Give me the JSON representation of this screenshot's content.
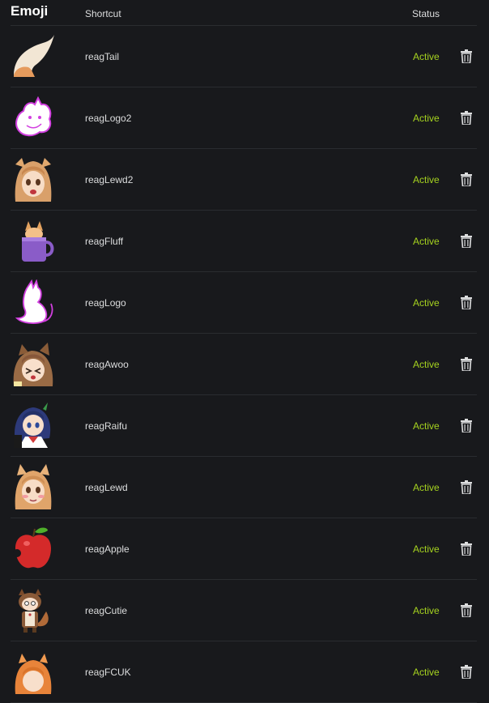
{
  "header": {
    "emoji_label": "Emoji",
    "shortcut_label": "Shortcut",
    "status_label": "Status"
  },
  "colors": {
    "background": "#18191c",
    "status_active": "#a5d21f",
    "divider": "#2a2c30"
  },
  "rows": [
    {
      "shortcut": "reagTail",
      "status": "Active",
      "icon": "fox-tail-icon"
    },
    {
      "shortcut": "reagLogo2",
      "status": "Active",
      "icon": "white-creature-logo-icon"
    },
    {
      "shortcut": "reagLewd2",
      "status": "Active",
      "icon": "anime-fox-girl-icon"
    },
    {
      "shortcut": "reagFluff",
      "status": "Active",
      "icon": "fox-in-mug-icon"
    },
    {
      "shortcut": "reagLogo",
      "status": "Active",
      "icon": "sitting-fox-logo-icon"
    },
    {
      "shortcut": "reagAwoo",
      "status": "Active",
      "icon": "anime-wolf-girl-icon"
    },
    {
      "shortcut": "reagRaifu",
      "status": "Active",
      "icon": "anime-schoolgirl-icon"
    },
    {
      "shortcut": "reagLewd",
      "status": "Active",
      "icon": "blushing-fox-girl-icon"
    },
    {
      "shortcut": "reagApple",
      "status": "Active",
      "icon": "red-apple-icon"
    },
    {
      "shortcut": "reagCutie",
      "status": "Active",
      "icon": "chibi-fox-girl-icon"
    },
    {
      "shortcut": "reagFCUK",
      "status": "Active",
      "icon": "orange-fox-girl-icon"
    }
  ]
}
